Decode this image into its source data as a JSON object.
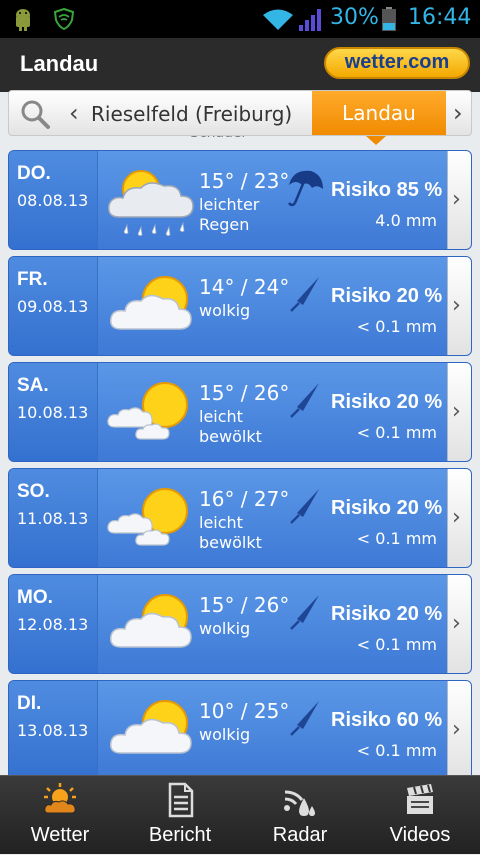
{
  "status_bar": {
    "battery_percent": "30%",
    "time": "16:44",
    "icons": [
      "android-debug-icon",
      "shield-icon",
      "wifi-icon",
      "signal-icon",
      "battery-icon"
    ]
  },
  "app_bar": {
    "title": "Landau",
    "logo": "wetter.com"
  },
  "location_bar": {
    "previous_location": "Rieselfeld (Freiburg)",
    "current_location": "Landau",
    "peek_text": "Schauer"
  },
  "forecast": [
    {
      "day": "DO.",
      "date": "08.08.13",
      "temps": "15° / 23°",
      "condition": "leichter Regen",
      "icon": "rain-cloud-sun-icon",
      "risk": "Risiko 85 %",
      "precip": "4.0 mm",
      "umbrella": "open-umbrella-icon"
    },
    {
      "day": "FR.",
      "date": "09.08.13",
      "temps": "14° / 24°",
      "condition": "wolkig",
      "icon": "cloudy-sun-icon",
      "risk": "Risiko 20 %",
      "precip": "< 0.1 mm",
      "umbrella": "closed-umbrella-icon"
    },
    {
      "day": "SA.",
      "date": "10.08.13",
      "temps": "15° / 26°",
      "condition": "leicht bewölkt",
      "icon": "partly-cloudy-icon",
      "risk": "Risiko 20 %",
      "precip": "< 0.1 mm",
      "umbrella": "closed-umbrella-icon"
    },
    {
      "day": "SO.",
      "date": "11.08.13",
      "temps": "16° / 27°",
      "condition": "leicht bewölkt",
      "icon": "partly-cloudy-icon",
      "risk": "Risiko 20 %",
      "precip": "< 0.1 mm",
      "umbrella": "closed-umbrella-icon"
    },
    {
      "day": "MO.",
      "date": "12.08.13",
      "temps": "15° / 26°",
      "condition": "wolkig",
      "icon": "cloudy-sun-icon",
      "risk": "Risiko 20 %",
      "precip": "< 0.1 mm",
      "umbrella": "closed-umbrella-icon"
    },
    {
      "day": "DI.",
      "date": "13.08.13",
      "temps": "10° / 25°",
      "condition": "wolkig",
      "icon": "cloudy-sun-icon",
      "risk": "Risiko 60 %",
      "precip": "< 0.1 mm",
      "umbrella": "closed-umbrella-icon"
    }
  ],
  "bottom_nav": [
    {
      "label": "Wetter",
      "icon": "weather-icon",
      "active": true
    },
    {
      "label": "Bericht",
      "icon": "report-icon",
      "active": false
    },
    {
      "label": "Radar",
      "icon": "radar-icon",
      "active": false
    },
    {
      "label": "Videos",
      "icon": "video-clapper-icon",
      "active": false
    }
  ],
  "colors": {
    "accent_orange": "#f08a00",
    "card_blue": "#4a86dd",
    "status_blue": "#33b5e5"
  }
}
